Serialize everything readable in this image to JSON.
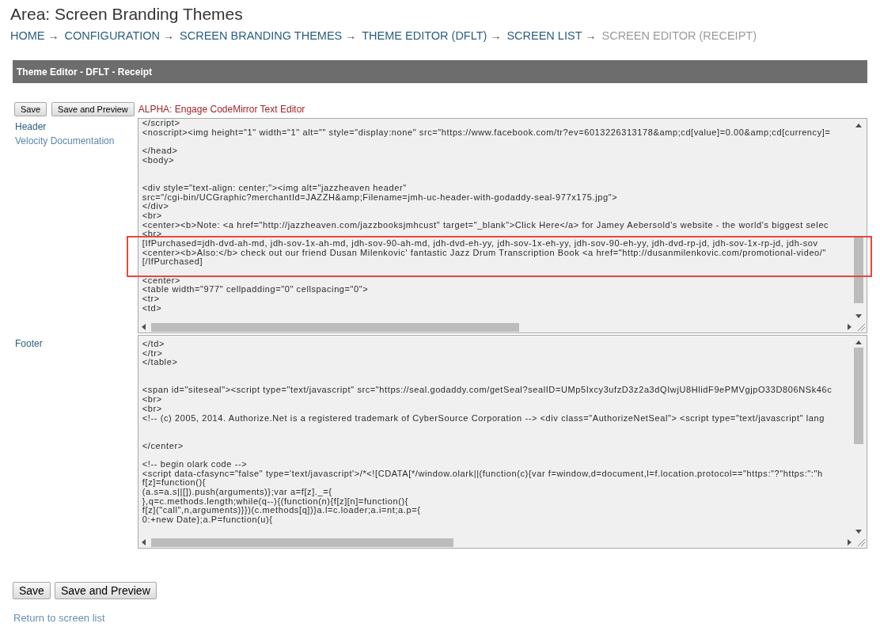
{
  "page_title": "Area: Screen Branding Themes",
  "breadcrumb": [
    {
      "label": "HOME",
      "arrow": "→",
      "current": false
    },
    {
      "label": "CONFIGURATION",
      "arrow": "→",
      "current": false
    },
    {
      "label": "SCREEN BRANDING THEMES",
      "arrow": "→",
      "current": false
    },
    {
      "label": "THEME EDITOR (DFLT)",
      "arrow": "→",
      "current": false
    },
    {
      "label": "SCREEN LIST",
      "arrow": "→",
      "current": false
    },
    {
      "label": "SCREEN EDITOR (RECEIPT)",
      "current": true
    }
  ],
  "panel": {
    "title": "Theme Editor - DFLT - Receipt"
  },
  "toolbar": {
    "buttons": [
      "Save",
      "Save and Preview"
    ],
    "editor_link": "ALPHA: Engage CodeMirror Text Editor"
  },
  "editors": [
    {
      "label": "Header",
      "doc_link": "Velocity Documentation",
      "lines": [
        {
          "kind": "code",
          "text": "</script>",
          "highlighted": false
        },
        {
          "kind": "code",
          "text": "<noscript><img height=\"1\" width=\"1\" alt=\"\" style=\"display:none\" src=\"https://www.facebook.com/tr?ev=6013226313178&amp;cd[value]=0.00&amp;cd[currency]=",
          "highlighted": false
        },
        {
          "kind": "blank",
          "highlighted": false
        },
        {
          "kind": "code",
          "text": "</head>",
          "highlighted": false
        },
        {
          "kind": "code",
          "text": "<body>",
          "highlighted": false
        },
        {
          "kind": "blank",
          "highlighted": false
        },
        {
          "kind": "blank",
          "highlighted": false
        },
        {
          "kind": "code",
          "text": "<div style=\"text-align: center;\"><img alt=\"jazzheaven header\"",
          "highlighted": false
        },
        {
          "kind": "code",
          "text": "src=\"/cgi-bin/UCGraphic?merchantId=JAZZH&amp;Filename=jmh-uc-header-with-godaddy-seal-977x175.jpg\">",
          "highlighted": false
        },
        {
          "kind": "code",
          "text": "</div>",
          "highlighted": false
        },
        {
          "kind": "code",
          "text": "<br>",
          "highlighted": false
        },
        {
          "kind": "code",
          "text": "<center><b>Note: <a href=\"http://jazzheaven.com/jazzbooksjmhcust\" target=\"_blank\">Click Here</a> for Jamey Aebersold's website - the world's biggest selec",
          "highlighted": false
        },
        {
          "kind": "code",
          "text": "<br>",
          "highlighted": false
        },
        {
          "kind": "code",
          "text": "[IfPurchased=jdh-dvd-ah-md, jdh-sov-1x-ah-md, jdh-sov-90-ah-md, jdh-dvd-eh-yy, jdh-sov-1x-eh-yy, jdh-sov-90-eh-yy, jdh-dvd-rp-jd, jdh-sov-1x-rp-jd, jdh-sov",
          "highlighted": true
        },
        {
          "kind": "code",
          "text": "<center><b>Also:</b> check out our friend Dusan Milenkovic' fantastic Jazz Drum Transcription Book <a href=\"http://dusanmilenkovic.com/promotional-video/\"",
          "highlighted": true
        },
        {
          "kind": "code",
          "text": "[/IfPurchased]",
          "highlighted": true
        },
        {
          "kind": "blank",
          "highlighted": true
        },
        {
          "kind": "code",
          "text": "<center>",
          "highlighted": false
        },
        {
          "kind": "code",
          "text": "<table width=\"977\" cellpadding=\"0\" cellspacing=\"0\">",
          "highlighted": false
        },
        {
          "kind": "code",
          "text": "<tr>",
          "highlighted": false
        },
        {
          "kind": "code",
          "text": "<td>",
          "highlighted": false
        }
      ]
    },
    {
      "label": "Footer",
      "lines": [
        {
          "kind": "code",
          "text": "</td>"
        },
        {
          "kind": "code",
          "text": "</tr>"
        },
        {
          "kind": "code",
          "text": "</table>"
        },
        {
          "kind": "blank"
        },
        {
          "kind": "blank"
        },
        {
          "kind": "code",
          "text": "<span id=\"siteseal\"><script type=\"text/javascript\" src=\"https://seal.godaddy.com/getSeal?sealID=UMp5Ixcy3ufzD3z2a3dQIwjU8HlidF9ePMVgjpO33D806NSk46c"
        },
        {
          "kind": "code",
          "text": "<br>"
        },
        {
          "kind": "code",
          "text": "<br>"
        },
        {
          "kind": "code",
          "text": "<!-- (c) 2005, 2014. Authorize.Net is a registered trademark of CyberSource Corporation --> <div class=\"AuthorizeNetSeal\"> <script type=\"text/javascript\" lang"
        },
        {
          "kind": "blank"
        },
        {
          "kind": "blank"
        },
        {
          "kind": "code",
          "text": "</center>"
        },
        {
          "kind": "blank"
        },
        {
          "kind": "code",
          "text": "<!-- begin olark code -->"
        },
        {
          "kind": "code",
          "text": "<script data-cfasync=\"false\" type='text/javascript'>/*<![CDATA[*/window.olark||(function(c){var f=window,d=document,l=f.location.protocol==\"https:\"?\"https:\":\"h"
        },
        {
          "kind": "code",
          "text": "f[z]=function(){"
        },
        {
          "kind": "code",
          "text": "(a.s=a.s||[]).push(arguments)};var a=f[z]._={"
        },
        {
          "kind": "code",
          "text": "},q=c.methods.length;while(q--){(function(n){f[z][n]=function(){"
        },
        {
          "kind": "code",
          "text": "f[z](\"call\",n,arguments)}})(c.methods[q])}a.l=c.loader;a.i=nt;a.p={"
        },
        {
          "kind": "code",
          "text": "0:+new Date};a.P=function(u){"
        }
      ]
    }
  ],
  "footer_buttons": [
    "Save",
    "Save and Preview"
  ],
  "return_link": "Return to screen list"
}
